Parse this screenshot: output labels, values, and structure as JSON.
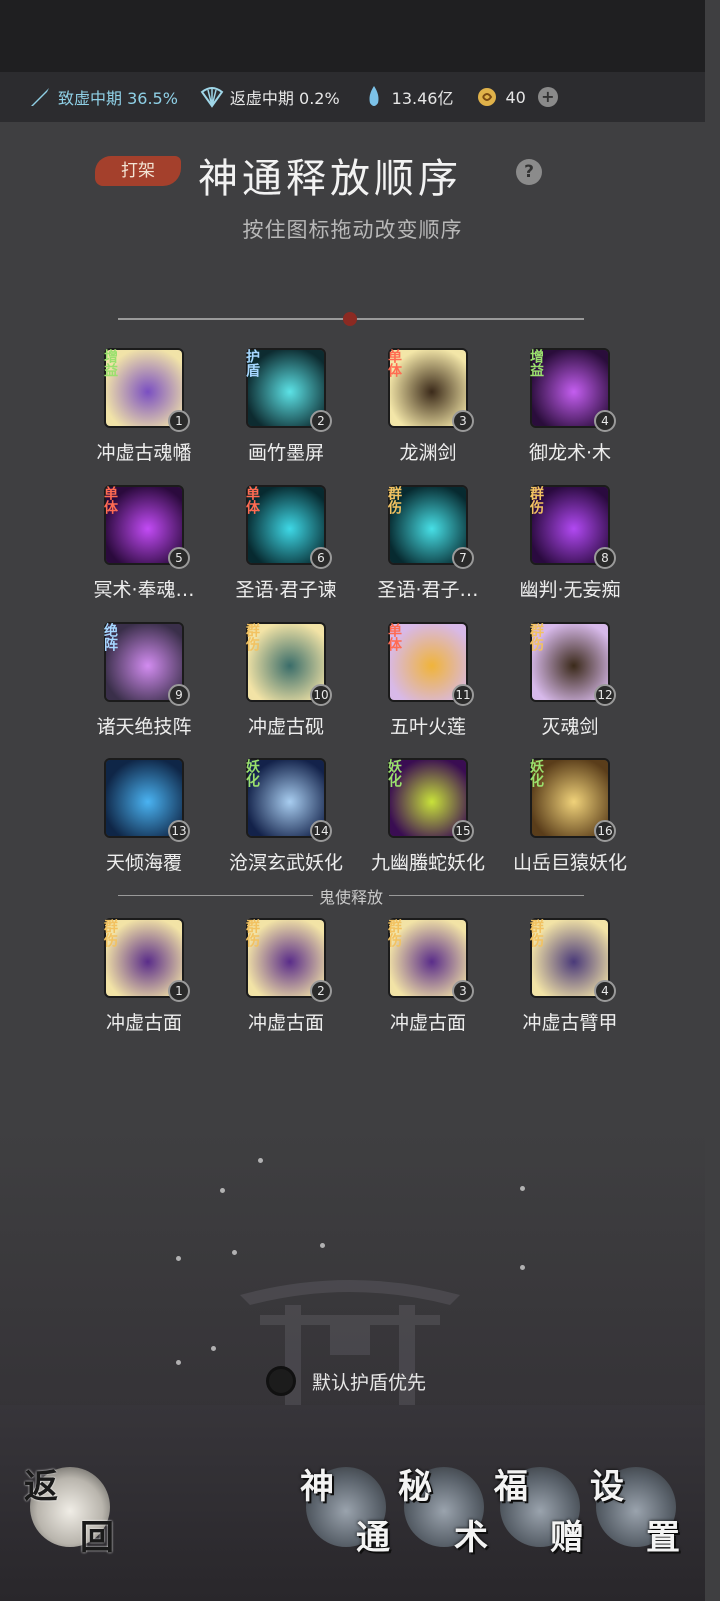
{
  "resources": [
    {
      "icon": "sword-icon",
      "label": "致虚中期 36.5%",
      "tone": "cyan"
    },
    {
      "icon": "fan-icon",
      "label": "返虚中期 0.2%",
      "tone": "plain"
    },
    {
      "icon": "crystal-icon",
      "label": "13.46亿",
      "tone": "plain"
    },
    {
      "icon": "coin-icon",
      "label": "40",
      "tone": "plain"
    }
  ],
  "header": {
    "tag": "打架",
    "title": "神通释放顺序",
    "help": "?",
    "subtitle": "按住图标拖动改变顺序"
  },
  "skills": [
    {
      "badge": "增益",
      "type": "buff",
      "num": "1",
      "name": "冲虚古魂幡",
      "c1": "#f1e3a8",
      "c2": "#7a4fc2"
    },
    {
      "badge": "护盾",
      "type": "shield",
      "num": "2",
      "name": "画竹墨屏",
      "c1": "#0d2b30",
      "c2": "#5ce2e6"
    },
    {
      "badge": "单体",
      "type": "single",
      "num": "3",
      "name": "龙渊剑",
      "c1": "#f3e6a8",
      "c2": "#3b2a1a"
    },
    {
      "badge": "增益",
      "type": "buff",
      "num": "4",
      "name": "御龙术·木",
      "c1": "#2a0d3b",
      "c2": "#c45ef0"
    },
    {
      "badge": "单体",
      "type": "single",
      "num": "5",
      "name": "冥术·奉魂…",
      "c1": "#2b0a3d",
      "c2": "#c24bf5"
    },
    {
      "badge": "单体",
      "type": "single",
      "num": "6",
      "name": "圣语·君子谏",
      "c1": "#072a30",
      "c2": "#3ed8e6"
    },
    {
      "badge": "群伤",
      "type": "aoe",
      "num": "7",
      "name": "圣语·君子…",
      "c1": "#072a30",
      "c2": "#47dfe6"
    },
    {
      "badge": "群伤",
      "type": "aoe",
      "num": "8",
      "name": "幽判·无妄痴",
      "c1": "#2a0a3f",
      "c2": "#b149f2"
    },
    {
      "badge": "绝阵",
      "type": "formation",
      "num": "9",
      "name": "诸天绝技阵",
      "c1": "#3a2f4a",
      "c2": "#d28cf0"
    },
    {
      "badge": "群伤",
      "type": "aoe",
      "num": "10",
      "name": "冲虚古砚",
      "c1": "#f2e3a6",
      "c2": "#3a6d6a"
    },
    {
      "badge": "单体",
      "type": "single",
      "num": "11",
      "name": "五叶火莲",
      "c1": "#d8b9e8",
      "c2": "#f0b43a"
    },
    {
      "badge": "群伤",
      "type": "aoe",
      "num": "12",
      "name": "灭魂剑",
      "c1": "#d7b9ea",
      "c2": "#3b2a1a"
    },
    {
      "badge": "",
      "type": "none",
      "num": "13",
      "name": "天倾海覆",
      "c1": "#0f2647",
      "c2": "#4ab3f2"
    },
    {
      "badge": "妖化",
      "type": "demon",
      "num": "14",
      "name": "沧溟玄武妖化",
      "c1": "#13224a",
      "c2": "#a8cdf0"
    },
    {
      "badge": "妖化",
      "type": "demon",
      "num": "15",
      "name": "九幽螣蛇妖化",
      "c1": "#3a0d52",
      "c2": "#c8e23a"
    },
    {
      "badge": "妖化",
      "type": "demon",
      "num": "16",
      "name": "山岳巨猿妖化",
      "c1": "#5a3d1a",
      "c2": "#f0d27a"
    }
  ],
  "ghost": {
    "label": "鬼使释放",
    "items": [
      {
        "badge": "群伤",
        "type": "aoe",
        "num": "1",
        "name": "冲虚古面",
        "c1": "#f2e3a6",
        "c2": "#5a2d8a"
      },
      {
        "badge": "群伤",
        "type": "aoe",
        "num": "2",
        "name": "冲虚古面",
        "c1": "#f2e3a6",
        "c2": "#5a2d8a"
      },
      {
        "badge": "群伤",
        "type": "aoe",
        "num": "3",
        "name": "冲虚古面",
        "c1": "#f2e3a6",
        "c2": "#5a2d8a"
      },
      {
        "badge": "群伤",
        "type": "aoe",
        "num": "4",
        "name": "冲虚古臂甲",
        "c1": "#f2e3a6",
        "c2": "#4a3a7a"
      }
    ]
  },
  "toggle": {
    "label": "默认护盾优先"
  },
  "nav": [
    {
      "name": "back-button",
      "g1": "返",
      "g2": "回"
    },
    {
      "name": "nav-shentong-button",
      "g1": "神",
      "g2": "通"
    },
    {
      "name": "nav-mishu-button",
      "g1": "秘",
      "g2": "术"
    },
    {
      "name": "nav-fuzeng-button",
      "g1": "福",
      "g2": "赠"
    },
    {
      "name": "nav-settings-button",
      "g1": "设",
      "g2": "置"
    }
  ]
}
